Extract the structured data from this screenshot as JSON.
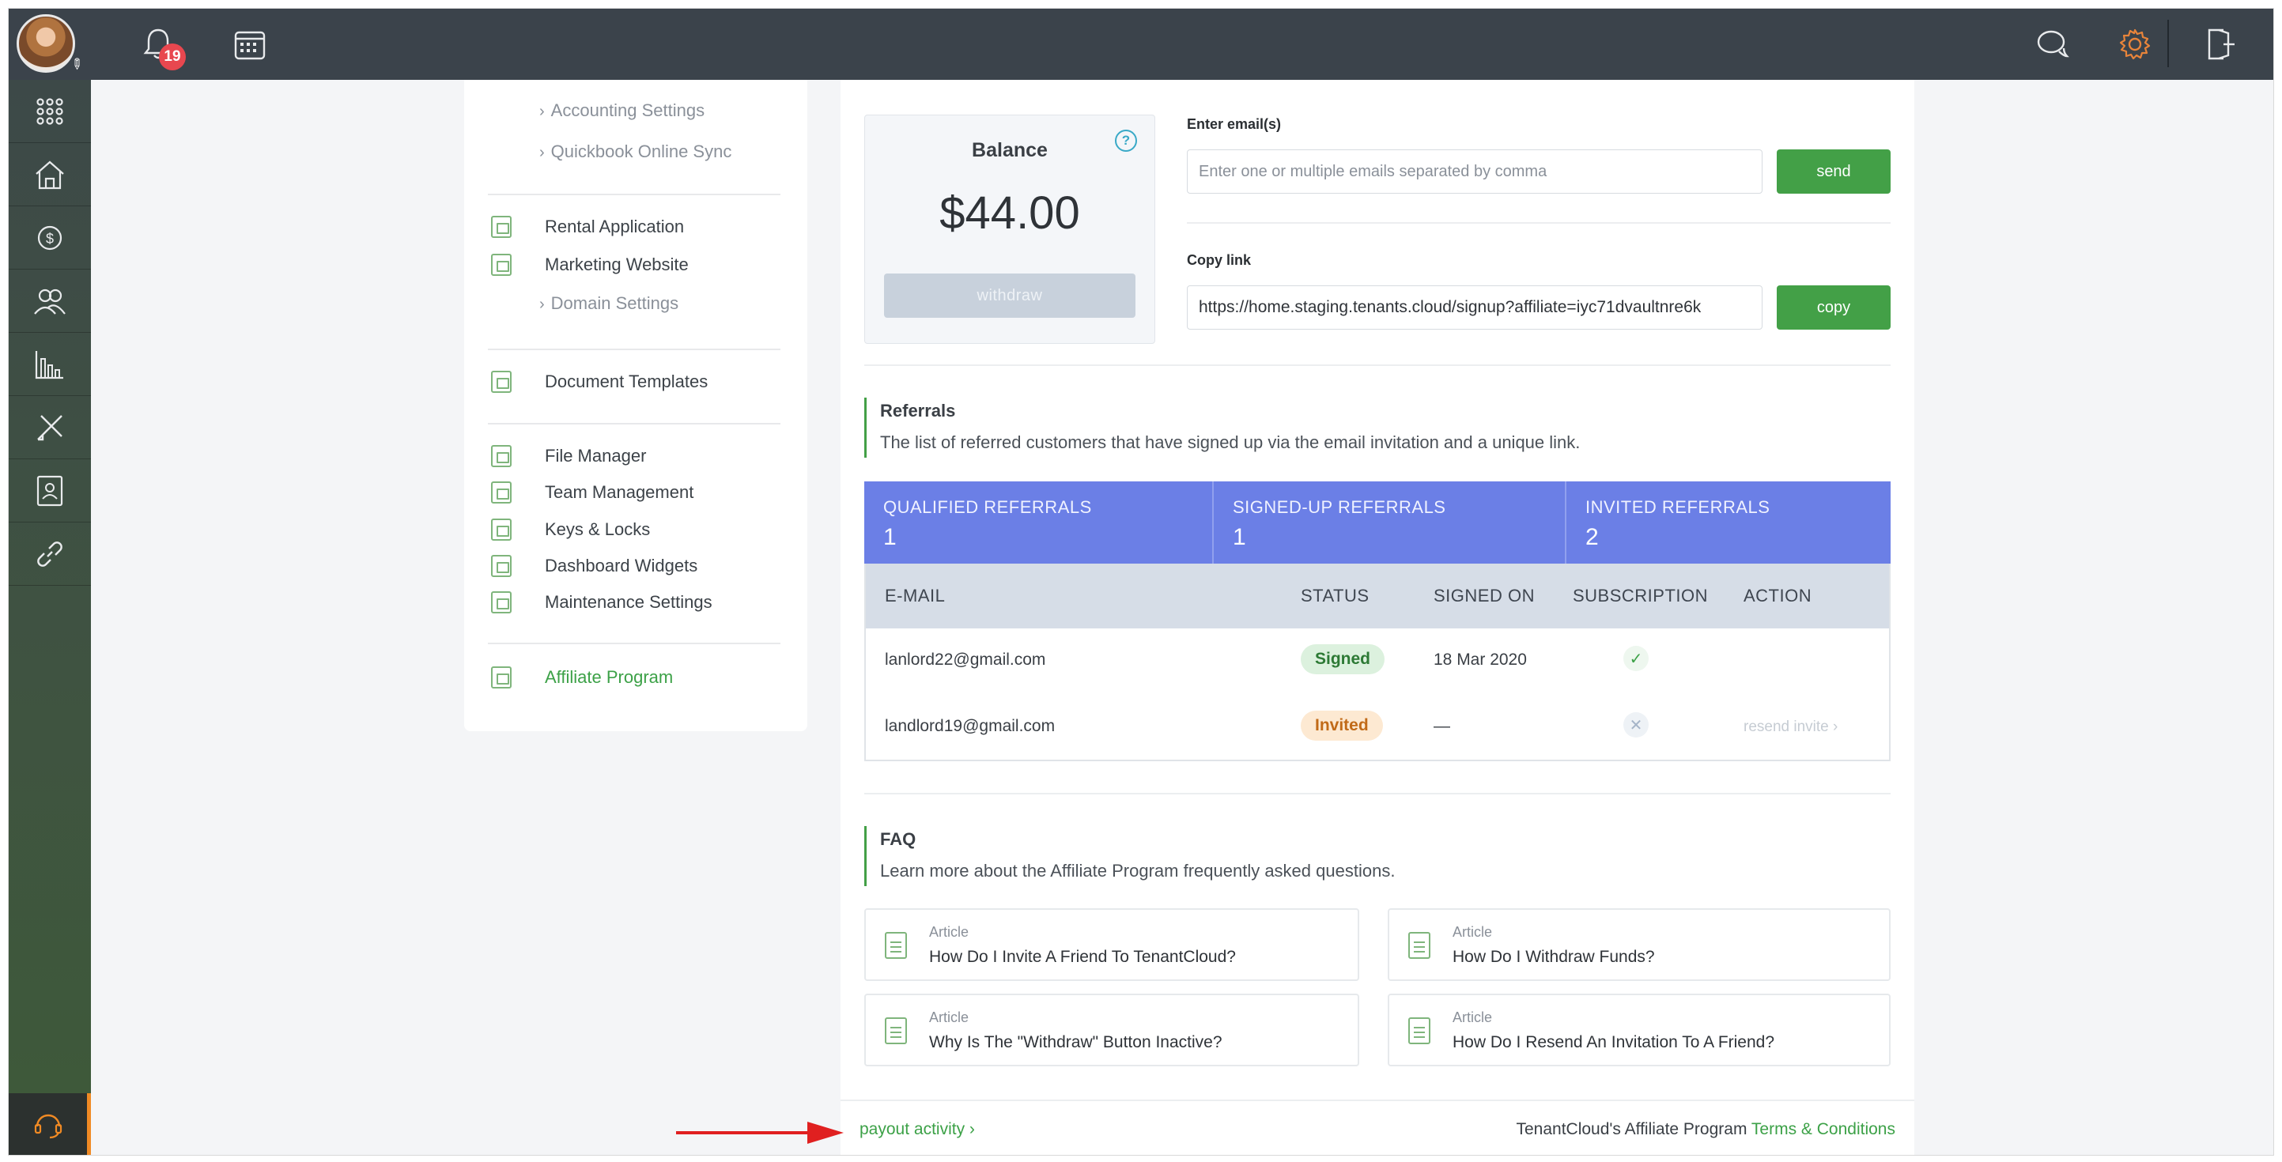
{
  "topbar": {
    "notification_count": "19"
  },
  "rail": {
    "items": [
      "apps",
      "properties",
      "payments",
      "people",
      "reports",
      "maintenance",
      "applications",
      "integrations"
    ],
    "support": "support"
  },
  "settings": {
    "sub_links_top": [
      "Accounting Settings",
      "Quickbook Online Sync"
    ],
    "links_group1": [
      "Rental Application",
      "Marketing Website"
    ],
    "domain_settings": "Domain Settings",
    "links_group2": [
      "Document Templates"
    ],
    "links_group3": [
      "File Manager",
      "Team Management",
      "Keys & Locks",
      "Dashboard Widgets",
      "Maintenance Settings"
    ],
    "active_link": "Affiliate Program"
  },
  "balance": {
    "title": "Balance",
    "amount": "$44.00",
    "withdraw_label": "withdraw",
    "help": "?"
  },
  "invite": {
    "email_label": "Enter email(s)",
    "email_placeholder": "Enter one or multiple emails separated by comma",
    "send_label": "send",
    "copy_label": "Copy link",
    "link_value": "https://home.staging.tenants.cloud/signup?affiliate=iyc71dvaultnre6k",
    "copy_button": "copy"
  },
  "referrals": {
    "title": "Referrals",
    "description": "The list of referred customers that have signed up via the email invitation and a unique link.",
    "stats": [
      {
        "label": "QUALIFIED REFERRALS",
        "value": "1"
      },
      {
        "label": "SIGNED-UP REFERRALS",
        "value": "1"
      },
      {
        "label": "INVITED REFERRALS",
        "value": "2"
      }
    ],
    "columns": [
      "E-MAIL",
      "STATUS",
      "SIGNED ON",
      "SUBSCRIPTION",
      "ACTION"
    ],
    "rows": [
      {
        "email": "lanlord22@gmail.com",
        "status": "Signed",
        "signed_on": "18 Mar 2020",
        "subscription": "active",
        "action": ""
      },
      {
        "email": "landlord19@gmail.com",
        "status": "Invited",
        "signed_on": "—",
        "subscription": "none",
        "action": "resend invite"
      }
    ]
  },
  "faq": {
    "title": "FAQ",
    "description": "Learn more about the Affiliate Program frequently asked questions.",
    "articles": [
      {
        "kicker": "Article",
        "title": "How Do I Invite A Friend To TenantCloud?"
      },
      {
        "kicker": "Article",
        "title": "How Do I Withdraw Funds?"
      },
      {
        "kicker": "Article",
        "title": "Why Is The \"Withdraw\" Button Inactive?"
      },
      {
        "kicker": "Article",
        "title": "How Do I Resend An Invitation To A Friend?"
      }
    ]
  },
  "footer": {
    "payout_label": "payout activity",
    "program_text": "TenantCloud's Affiliate Program",
    "terms_link": "Terms & Conditions"
  },
  "colors": {
    "accent_green": "#43a047",
    "stats_blue": "#6b7fe6",
    "topbar": "#3b434b",
    "settings_gear": "#e8843a",
    "arrow_red": "#e02020"
  }
}
